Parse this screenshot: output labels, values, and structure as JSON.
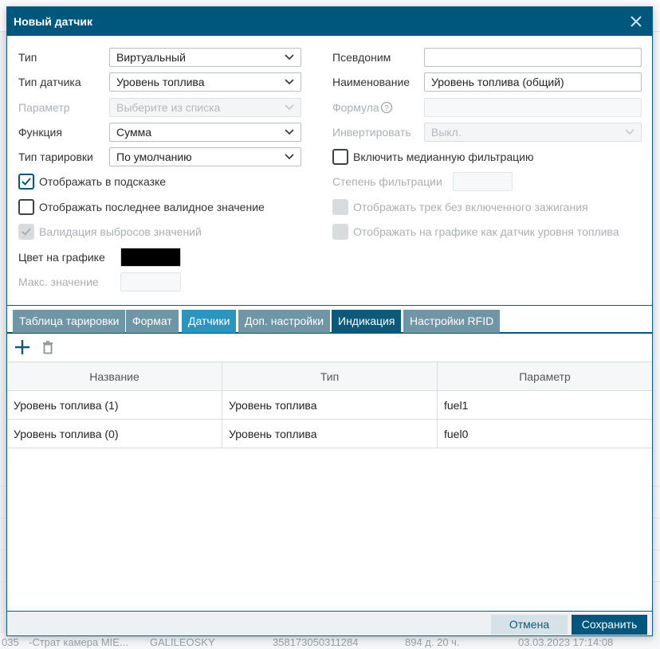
{
  "background": {
    "status_cells": [
      "035",
      "-Страт камера MIE...",
      "GALILEOSKY",
      "358173050311284",
      "894 д. 20 ч.",
      "03.03.2023 17:14:08"
    ]
  },
  "dialog": {
    "title": "Новый датчик",
    "close_icon": "close-icon",
    "form": {
      "type": {
        "label": "Тип",
        "value": "Виртуальный"
      },
      "sensor_type": {
        "label": "Тип датчика",
        "value": "Уровень топлива"
      },
      "parameter": {
        "label": "Параметр",
        "placeholder": "Выберите из списка"
      },
      "function": {
        "label": "Функция",
        "value": "Сумма"
      },
      "calibration_type": {
        "label": "Тип тарировки",
        "value": "По умолчанию"
      },
      "show_in_tooltip": {
        "label": "Отображать в подсказке",
        "checked": true
      },
      "show_last_valid": {
        "label": "Отображать последнее валидное значение",
        "checked": false
      },
      "outlier_validation": {
        "label": "Валидация выбросов значений",
        "checked": true,
        "disabled": true
      },
      "chart_color": {
        "label": "Цвет на графике",
        "value": "#000000"
      },
      "max_value": {
        "label": "Макс. значение",
        "value": ""
      },
      "alias": {
        "label": "Псевдоним",
        "value": ""
      },
      "name": {
        "label": "Наименование",
        "value": "Уровень топлива (общий)"
      },
      "formula": {
        "label": "Формула",
        "value": "",
        "help_icon": "help-icon"
      },
      "invert": {
        "label": "Инвертировать",
        "value": "Выкл."
      },
      "median_filter": {
        "label": "Включить медианную фильтрацию",
        "checked": false
      },
      "filter_degree": {
        "label": "Степень фильтрации",
        "value": ""
      },
      "track_without_ignition": {
        "label": "Отображать трек без включенного зажигания",
        "checked": false,
        "disabled": true
      },
      "show_as_fuel_sensor": {
        "label": "Отображать на графике как датчик уровня топлива",
        "checked": false,
        "disabled": true
      }
    },
    "tabs": [
      {
        "label": "Таблица тарировки",
        "style": "gray"
      },
      {
        "label": "Формат",
        "style": "gray"
      },
      {
        "label": "Датчики",
        "style": "blue"
      },
      {
        "label": "Доп. настройки",
        "style": "gray"
      },
      {
        "label": "Индикация",
        "style": "active"
      },
      {
        "label": "Настройки RFID",
        "style": "gray"
      }
    ],
    "toolbar": {
      "add_icon": "plus-icon",
      "delete_icon": "trash-icon"
    },
    "grid": {
      "columns": [
        "Название",
        "Тип",
        "Параметр"
      ],
      "rows": [
        [
          "Уровень топлива (1)",
          "Уровень топлива",
          "fuel1"
        ],
        [
          "Уровень топлива (0)",
          "Уровень топлива",
          "fuel0"
        ]
      ]
    },
    "footer": {
      "cancel_label": "Отмена",
      "save_label": "Сохранить"
    }
  },
  "colors": {
    "accent": "#00577d",
    "tab_gray": "#6f96a6",
    "tab_blue": "#2a95c1",
    "tab_active": "#0b5a7b"
  }
}
